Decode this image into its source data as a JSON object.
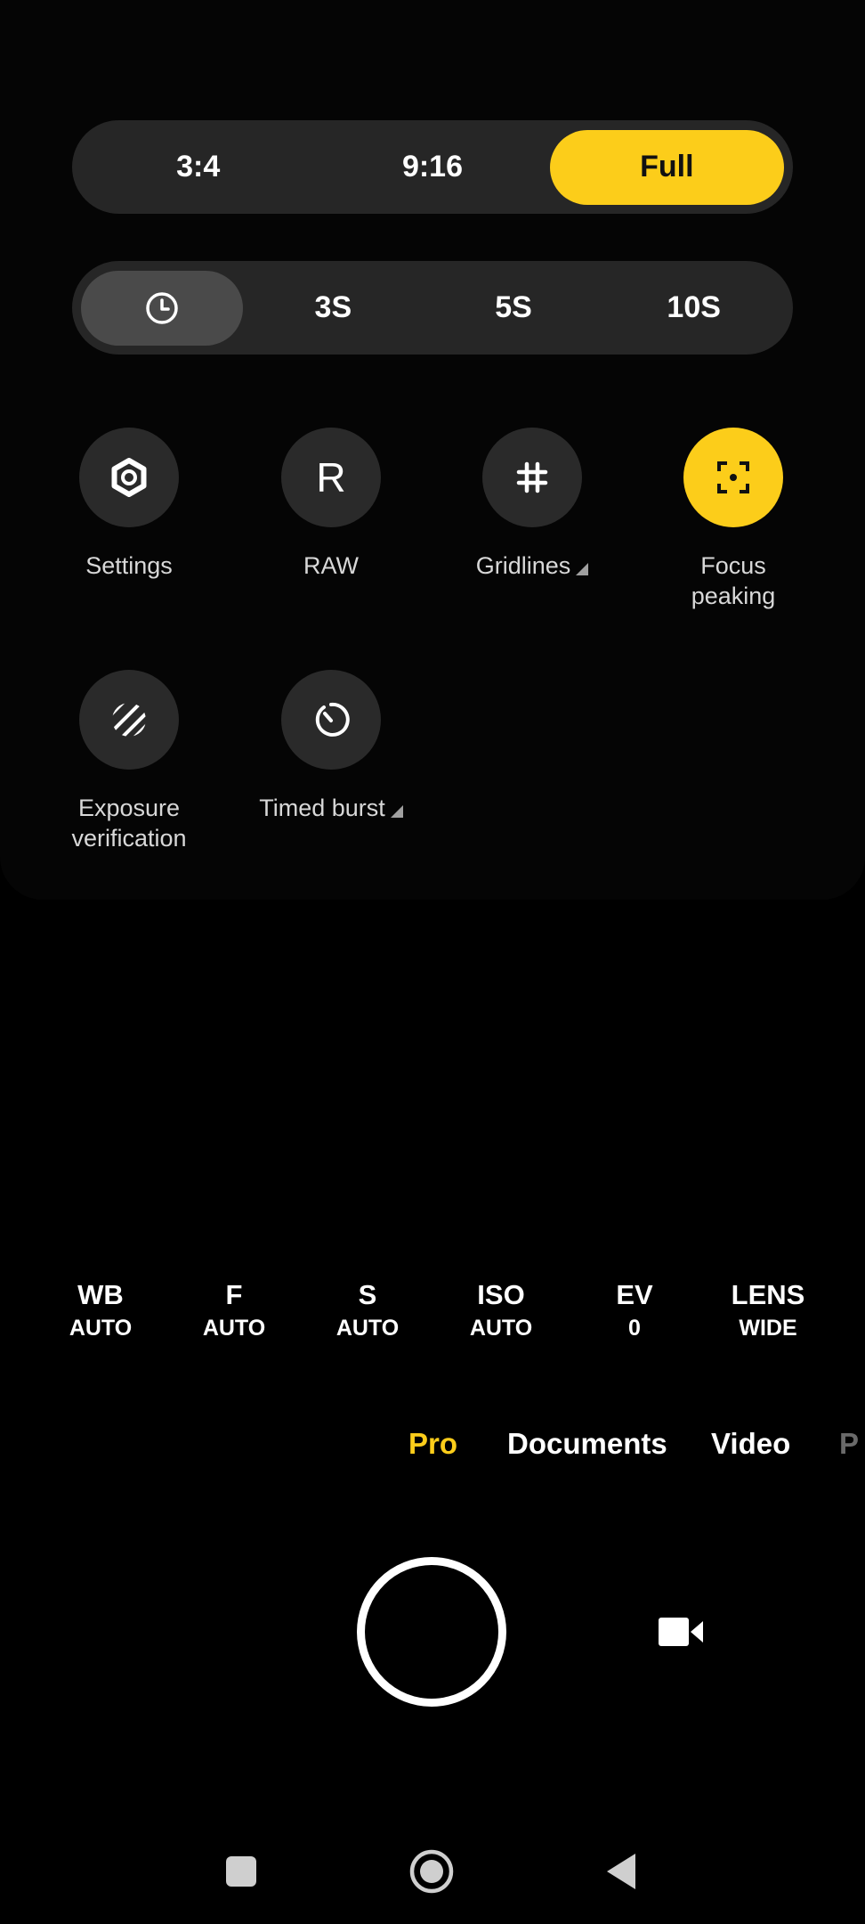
{
  "aspect_ratio": {
    "options": [
      "3:4",
      "9:16",
      "Full"
    ],
    "selected": "Full"
  },
  "timer": {
    "icon": "clock-icon",
    "options": [
      "3S",
      "5S",
      "10S"
    ]
  },
  "quick_settings": {
    "settings": "Settings",
    "raw": "RAW",
    "raw_glyph": "R",
    "gridlines": "Gridlines",
    "focus_peaking_line1": "Focus",
    "focus_peaking_line2": "peaking",
    "exposure_line1": "Exposure",
    "exposure_line2": "verification",
    "timed_burst": "Timed burst"
  },
  "pro_params": [
    {
      "key": "WB",
      "value": "AUTO"
    },
    {
      "key": "F",
      "value": "AUTO"
    },
    {
      "key": "S",
      "value": "AUTO"
    },
    {
      "key": "ISO",
      "value": "AUTO"
    },
    {
      "key": "EV",
      "value": "0"
    },
    {
      "key": "LENS",
      "value": "WIDE"
    }
  ],
  "modes": {
    "pro": "Pro",
    "documents": "Documents",
    "video": "Video",
    "partial": "P"
  },
  "colors": {
    "accent": "#fccd1a",
    "status_dot": "#2ecc71"
  }
}
